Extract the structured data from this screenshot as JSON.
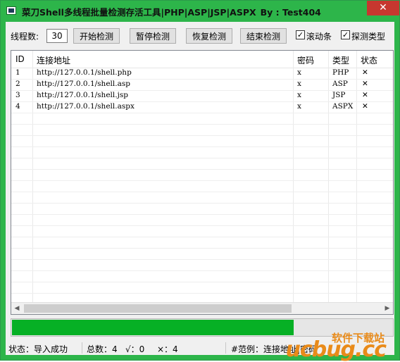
{
  "window": {
    "title": "菜刀Shell多线程批量检测存活工具|PHP|ASP|JSP|ASPX",
    "by": "By : Test404",
    "close": "✕"
  },
  "toolbar": {
    "threads_label": "线程数:",
    "threads_value": "30",
    "start_label": "开始检测",
    "pause_label": "暂停检测",
    "resume_label": "恢复检测",
    "stop_label": "结束检测",
    "scroll_label": "滚动条",
    "scroll_checked": "✓",
    "detect_type_label": "探测类型",
    "detect_type_checked": "✓"
  },
  "table": {
    "columns": [
      "ID",
      "连接地址",
      "密码",
      "类型",
      "状态"
    ],
    "rows": [
      {
        "id": "1",
        "url": "http://127.0.0.1/shell.php",
        "password": "x",
        "type": "PHP",
        "status": "✕"
      },
      {
        "id": "2",
        "url": "http://127.0.0.1/shell.asp",
        "password": "x",
        "type": "ASP",
        "status": "✕"
      },
      {
        "id": "3",
        "url": "http://127.0.0.1/shell.jsp",
        "password": "x",
        "type": "JSP",
        "status": "✕"
      },
      {
        "id": "4",
        "url": "http://127.0.0.1/shell.aspx",
        "password": "x",
        "type": "ASPX",
        "status": "✕"
      }
    ],
    "scroll_left": "◀",
    "scroll_right": "▶"
  },
  "progress": {
    "value": 0.74
  },
  "statusbar": {
    "status": "状态：导入成功",
    "total": "总数：4",
    "ok": "√：0",
    "fail": "×：4",
    "example": "#范例：连接地址|密码"
  },
  "watermark": {
    "text": "软件下载站",
    "logo": "ucbug.cc"
  }
}
